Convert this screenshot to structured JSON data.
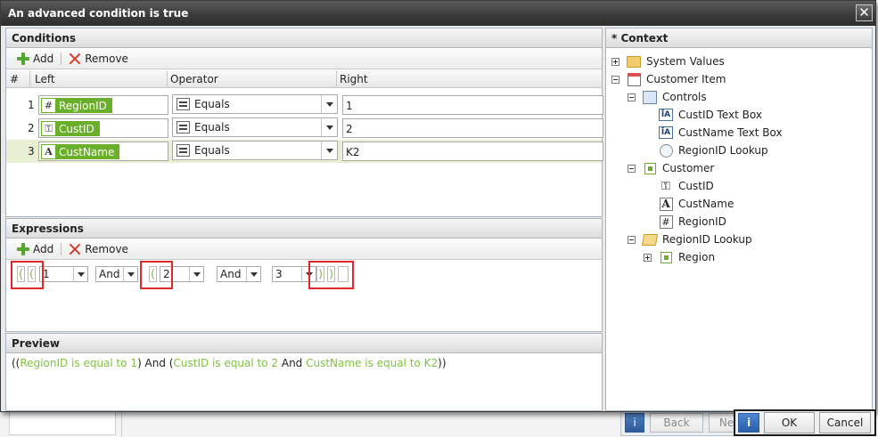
{
  "dialog": {
    "title": "An advanced condition is true"
  },
  "conditions": {
    "header": "Conditions",
    "add_label": "Add",
    "remove_label": "Remove",
    "columns": [
      "#",
      "Left",
      "Operator",
      "Right"
    ],
    "rows": [
      {
        "num": "1",
        "left": "RegionID",
        "left_icon": "hash-icon",
        "operator": "Equals",
        "right": "1"
      },
      {
        "num": "2",
        "left": "CustID",
        "left_icon": "key-icon",
        "operator": "Equals",
        "right": "2"
      },
      {
        "num": "3",
        "left": "CustName",
        "left_icon": "text-a-icon",
        "operator": "Equals",
        "right": "K2"
      }
    ]
  },
  "expressions": {
    "header": "Expressions",
    "add_label": "Add",
    "remove_label": "Remove",
    "parts": [
      "(",
      "(",
      "1",
      "And",
      "(",
      "2",
      "And",
      "3",
      ")",
      ")"
    ]
  },
  "preview": {
    "header": "Preview",
    "segments": [
      {
        "text": "((",
        "hl": false
      },
      {
        "text": "RegionID is equal to 1",
        "hl": true
      },
      {
        "text": ") And (",
        "hl": false
      },
      {
        "text": "CustID is equal to 2",
        "hl": true
      },
      {
        "text": " And ",
        "hl": false
      },
      {
        "text": "CustName is equal to K2",
        "hl": true
      },
      {
        "text": "))",
        "hl": false
      }
    ]
  },
  "context": {
    "header": "* Context",
    "tree": [
      {
        "label": "System Values",
        "icon": "folder-icon"
      },
      {
        "label": "Customer Item",
        "icon": "window-icon"
      },
      {
        "label": "Controls",
        "icon": "controls-icon"
      },
      {
        "label": "CustID Text Box",
        "icon": "textbox-icon"
      },
      {
        "label": "CustName Text Box",
        "icon": "textbox-icon"
      },
      {
        "label": "RegionID Lookup",
        "icon": "lookup-icon"
      },
      {
        "label": "Customer",
        "icon": "smartobject-icon"
      },
      {
        "label": "CustID",
        "icon": "key-icon"
      },
      {
        "label": "CustName",
        "icon": "text-a-icon"
      },
      {
        "label": "RegionID",
        "icon": "hash-icon"
      },
      {
        "label": "RegionID Lookup",
        "icon": "folder-open-icon"
      },
      {
        "label": "Region",
        "icon": "smartobject-icon"
      }
    ]
  },
  "footer": {
    "ok_label": "OK",
    "cancel_label": "Cancel",
    "back_label": "Back",
    "next_label": "Ne"
  },
  "colors": {
    "accent_green": "#6aaf2a",
    "highlight_red": "#e12727"
  }
}
